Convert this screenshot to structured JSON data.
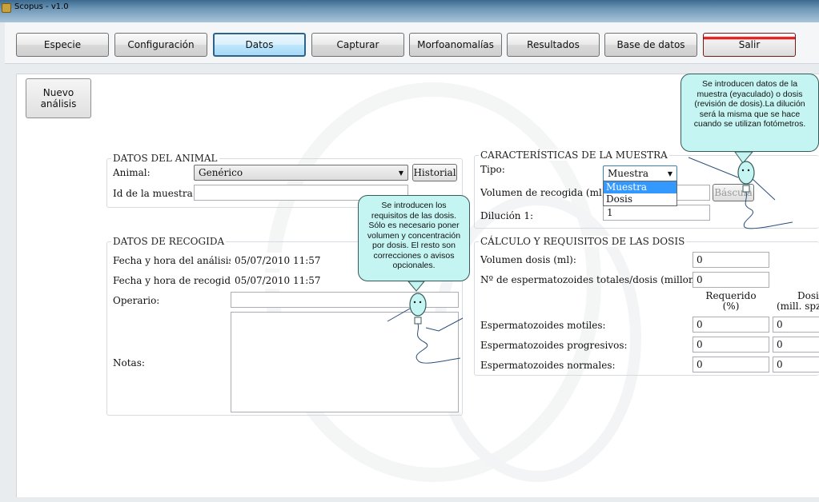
{
  "window": {
    "title": "Scopus - v1.0"
  },
  "toolbar": {
    "buttons": {
      "especie": "Especie",
      "configuracion": "Configuración",
      "datos": "Datos",
      "capturar": "Capturar",
      "morfoanomalias": "Morfoanomalías",
      "resultados": "Resultados",
      "base_datos": "Base de datos",
      "salir": "Salir"
    },
    "active": "Datos",
    "salir_color": "#e02020"
  },
  "actions": {
    "nuevo_line1": "Nuevo",
    "nuevo_line2": "análisis"
  },
  "animal": {
    "title": "DATOS DEL ANIMAL",
    "animal_label": "Animal:",
    "animal_value": "Genérico",
    "historial_label": "Historial",
    "id_label": "Id de la muestra:",
    "id_value": ""
  },
  "recogida": {
    "title": "DATOS DE RECOGIDA",
    "analisis_label": "Fecha y hora del análisis:",
    "analisis_value": "05/07/2010 11:57",
    "recogida_label": "Fecha y hora de recogida:",
    "recogida_value": "05/07/2010 11:57",
    "operario_label": "Operario:",
    "operario_value": "",
    "notas_label": "Notas:",
    "notas_value": ""
  },
  "muestra": {
    "title": "CARACTERÍSTICAS DE LA MUESTRA",
    "tipo_label": "Tipo:",
    "tipo_value": "Muestra",
    "tipo_options": [
      "Muestra",
      "Dosis"
    ],
    "volumen_label": "Volumen de recogida (ml):",
    "bascula_label": "Báscula",
    "dilucion_label": "Dilución 1:",
    "dilucion_value": "1"
  },
  "calculo": {
    "title": "CÁLCULO Y REQUISITOS DE LAS DOSIS",
    "volumen_dosis_label": "Volumen dosis (ml):",
    "volumen_dosis_value": "0",
    "espermatozoides_label": "Nº de espermatozoides totales/dosis (millones):",
    "espermatozoides_value": "0",
    "col_requerido_1": "Requerido",
    "col_requerido_2": "(%)",
    "col_dosis_1": "Dosis",
    "col_dosis_2": "(mill. spz/",
    "rows": [
      {
        "label": "Espermatozoides motiles:",
        "requerido": "0",
        "dosis": "0"
      },
      {
        "label": "Espermatozoides progresivos:",
        "requerido": "0",
        "dosis": "0"
      },
      {
        "label": "Espermatozoides normales:",
        "requerido": "0",
        "dosis": "0"
      }
    ]
  },
  "bubbles": {
    "muestra_tip": "Se introducen datos de la muestra (eyaculado) o dosis (revisión de dosis).La dilución será la misma que se hace cuando se utilizan fotómetros.",
    "dosis_tip": "Se introducen los requisitos de las dosis. Sólo es necesario poner volumen y concentración por dosis. El resto son correcciones o avisos opcionales.",
    "color": "#c4f5f2"
  }
}
